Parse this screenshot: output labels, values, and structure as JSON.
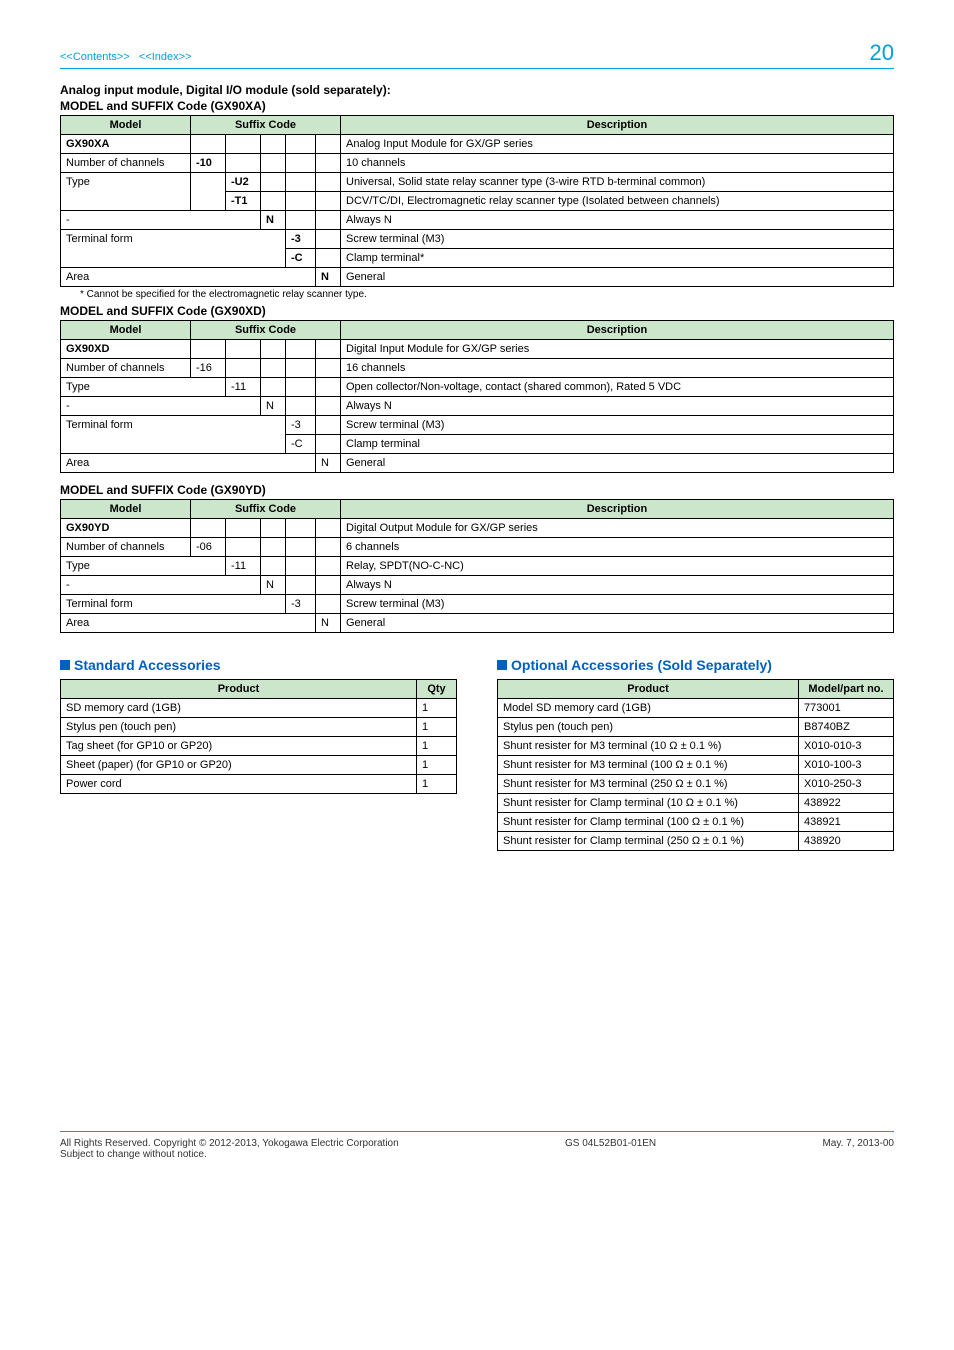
{
  "nav": {
    "contents": "<<Contents>>",
    "index": "<<Index>>",
    "page": "20"
  },
  "heading": {
    "line1": "Analog input module, Digital I/O module (sold separately):",
    "line2": "MODEL and SUFFIX Code (GX90XA)"
  },
  "tableXA": {
    "h_model": "Model",
    "h_suffix": "Suffix Code",
    "h_desc": "Description",
    "r0_label": "GX90XA",
    "r0_desc": "Analog Input Module for GX/GP series",
    "r1_label": "Number of channels",
    "r1_code": "-10",
    "r1_desc": "10 channels",
    "r2_label": "Type",
    "r2_code": "-U2",
    "r2_desc": "Universal, Solid state relay scanner type (3-wire RTD b-terminal common)",
    "r3_code": "-T1",
    "r3_desc": "DCV/TC/DI, Electromagnetic relay scanner type (Isolated between channels)",
    "r4_label": "-",
    "r4_code": "N",
    "r4_desc": "Always N",
    "r5_label": "Terminal form",
    "r5_code": "-3",
    "r5_desc": "Screw terminal (M3)",
    "r6_code": "-C",
    "r6_desc": "Clamp terminal*",
    "r7_label": "Area",
    "r7_code": "N",
    "r7_desc": "General"
  },
  "noteXA": "*          Cannot be specified for the electromagnetic relay scanner type.",
  "headingXD": "MODEL and SUFFIX Code (GX90XD)",
  "tableXD": {
    "h_model": "Model",
    "h_suffix": "Suffix Code",
    "h_desc": "Description",
    "r0_label": "GX90XD",
    "r0_desc": "Digital Input Module for GX/GP series",
    "r1_label": "Number of channels",
    "r1_code": "-16",
    "r1_desc": "16 channels",
    "r2_label": "Type",
    "r2_code": "-11",
    "r2_desc": "Open collector/Non-voltage, contact (shared common), Rated 5 VDC",
    "r3_label": "-",
    "r3_code": "N",
    "r3_desc": "Always N",
    "r4_label": "Terminal form",
    "r4_code": "-3",
    "r4_desc": "Screw terminal (M3)",
    "r5_code": "-C",
    "r5_desc": "Clamp terminal",
    "r6_label": "Area",
    "r6_code": "N",
    "r6_desc": "General"
  },
  "headingYD": "MODEL and SUFFIX Code (GX90YD)",
  "tableYD": {
    "h_model": "Model",
    "h_suffix": "Suffix Code",
    "h_desc": "Description",
    "r0_label": "GX90YD",
    "r0_desc": "Digital Output Module for GX/GP series",
    "r1_label": "Number of channels",
    "r1_code": "-06",
    "r1_desc": "6 channels",
    "r2_label": "Type",
    "r2_code": "-11",
    "r2_desc": "Relay, SPDT(NO-C-NC)",
    "r3_label": "-",
    "r3_code": "N",
    "r3_desc": "Always N",
    "r4_label": "Terminal form",
    "r4_code": "-3",
    "r4_desc": "Screw terminal (M3)",
    "r5_label": "Area",
    "r5_code": "N",
    "r5_desc": "General"
  },
  "std": {
    "title": "Standard Accessories",
    "h_product": "Product",
    "h_qty": "Qty",
    "rows": [
      {
        "p": "SD memory card (1GB)",
        "q": "1"
      },
      {
        "p": "Stylus pen (touch pen)",
        "q": "1"
      },
      {
        "p": "Tag sheet (for GP10 or GP20)",
        "q": "1"
      },
      {
        "p": "Sheet (paper) (for GP10 or GP20)",
        "q": "1"
      },
      {
        "p": "Power cord",
        "q": "1"
      }
    ]
  },
  "opt": {
    "title": "Optional Accessories (Sold Separately)",
    "h_product": "Product",
    "h_part": "Model/part no.",
    "rows": [
      {
        "p": "Model  SD memory card (1GB)",
        "n": "773001"
      },
      {
        "p": "Stylus pen (touch pen)",
        "n": "B8740BZ"
      },
      {
        "p": "Shunt resister for M3 terminal (10 Ω ± 0.1 %)",
        "n": "X010-010-3"
      },
      {
        "p": "Shunt resister for M3 terminal (100 Ω ± 0.1 %)",
        "n": "X010-100-3"
      },
      {
        "p": "Shunt resister for M3 terminal (250 Ω ± 0.1 %)",
        "n": "X010-250-3"
      },
      {
        "p": "Shunt resister for Clamp terminal (10 Ω ± 0.1 %)",
        "n": "438922"
      },
      {
        "p": "Shunt resister for Clamp terminal (100 Ω ± 0.1 %)",
        "n": "438921"
      },
      {
        "p": "Shunt resister for Clamp terminal (250 Ω ± 0.1 %)",
        "n": "438920"
      }
    ]
  },
  "footer": {
    "copyright": "All Rights Reserved. Copyright © 2012-2013, Yokogawa Electric Corporation",
    "notice": "Subject to change without notice.",
    "doc": "GS 04L52B01-01EN",
    "date": "May. 7, 2013-00"
  }
}
